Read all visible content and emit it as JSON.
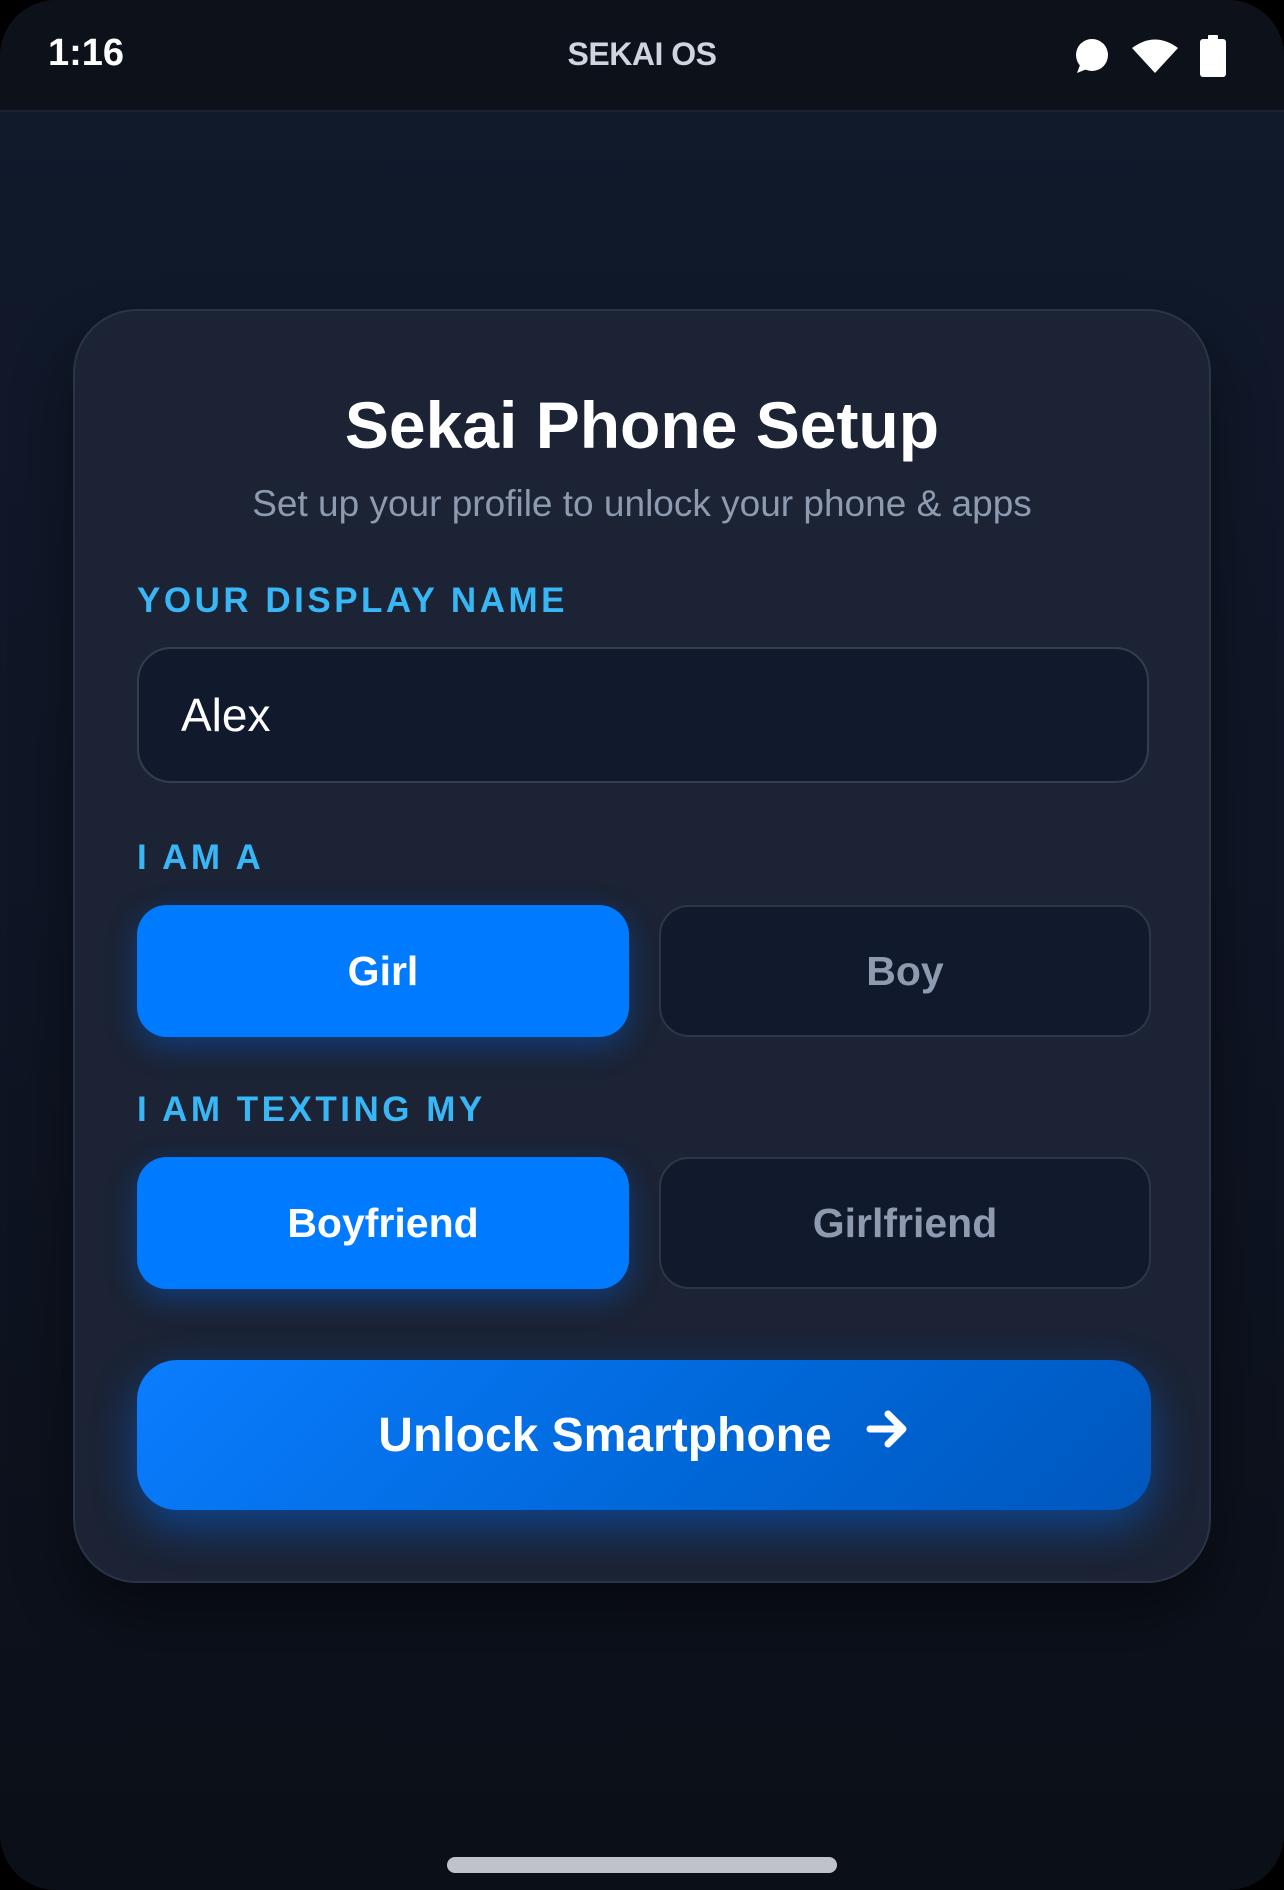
{
  "status_bar": {
    "time": "1:16",
    "title": "SEKAI OS",
    "icons": [
      "chat-bubble-icon",
      "wifi-icon",
      "battery-icon"
    ]
  },
  "setup": {
    "title": "Sekai Phone Setup",
    "subtitle": "Set up your profile to unlock your phone & apps",
    "display_name": {
      "label": "YOUR DISPLAY NAME",
      "value": "Alex"
    },
    "gender": {
      "label": "I AM A",
      "options": [
        "Girl",
        "Boy"
      ],
      "selected": "Girl"
    },
    "partner": {
      "label": "I AM TEXTING MY",
      "options": [
        "Boyfriend",
        "Girlfriend"
      ],
      "selected": "Boyfriend"
    },
    "unlock_button": {
      "label": "Unlock Smartphone",
      "icon": "arrow-right-icon"
    }
  },
  "colors": {
    "accent": "#007bff",
    "label": "#38b6f5",
    "card": "#1b2334",
    "background": "#0f1626"
  }
}
